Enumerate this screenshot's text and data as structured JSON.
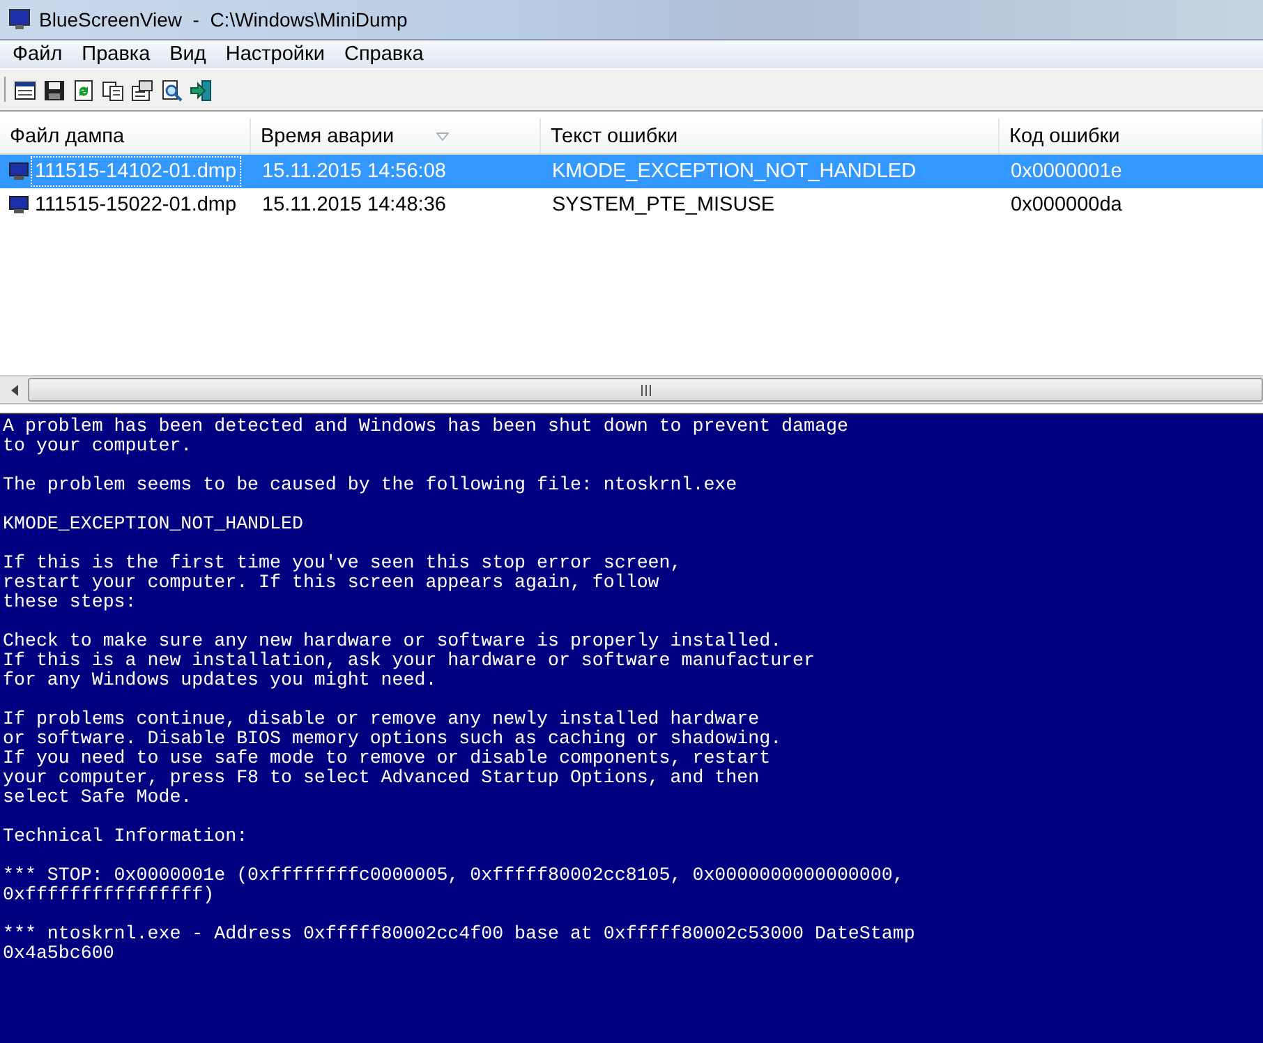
{
  "window": {
    "title": "BlueScreenView  -  C:\\Windows\\MiniDump"
  },
  "menu": [
    "Файл",
    "Правка",
    "Вид",
    "Настройки",
    "Справка"
  ],
  "table": {
    "columns": [
      {
        "label": "Файл дампа",
        "sorted": false
      },
      {
        "label": "Время аварии",
        "sorted": true
      },
      {
        "label": "Текст ошибки",
        "sorted": false
      },
      {
        "label": "Код ошибки",
        "sorted": false
      }
    ],
    "rows": [
      {
        "selected": true,
        "cells": [
          "111515-14102-01.dmp",
          "15.11.2015 14:56:08",
          "KMODE_EXCEPTION_NOT_HANDLED",
          "0x0000001e"
        ]
      },
      {
        "selected": false,
        "cells": [
          "111515-15022-01.dmp",
          "15.11.2015 14:48:36",
          "SYSTEM_PTE_MISUSE",
          "0x000000da"
        ]
      }
    ]
  },
  "bluescreen": {
    "paragraphs": [
      "A problem has been detected and Windows has been shut down to prevent damage\nto your computer.",
      "The problem seems to be caused by the following file: ntoskrnl.exe",
      "KMODE_EXCEPTION_NOT_HANDLED",
      "If this is the first time you've seen this stop error screen,\nrestart your computer. If this screen appears again, follow\nthese steps:",
      "Check to make sure any new hardware or software is properly installed.\nIf this is a new installation, ask your hardware or software manufacturer\nfor any Windows updates you might need.",
      "If problems continue, disable or remove any newly installed hardware\nor software. Disable BIOS memory options such as caching or shadowing.\nIf you need to use safe mode to remove or disable components, restart\nyour computer, press F8 to select Advanced Startup Options, and then\nselect Safe Mode.",
      "Technical Information:",
      "*** STOP: 0x0000001e (0xffffffffc0000005, 0xfffff80002cc8105, 0x0000000000000000,\n0xffffffffffffffff)",
      "*** ntoskrnl.exe - Address 0xfffff80002cc4f00 base at 0xfffff80002c53000 DateStamp\n0x4a5bc600"
    ]
  }
}
